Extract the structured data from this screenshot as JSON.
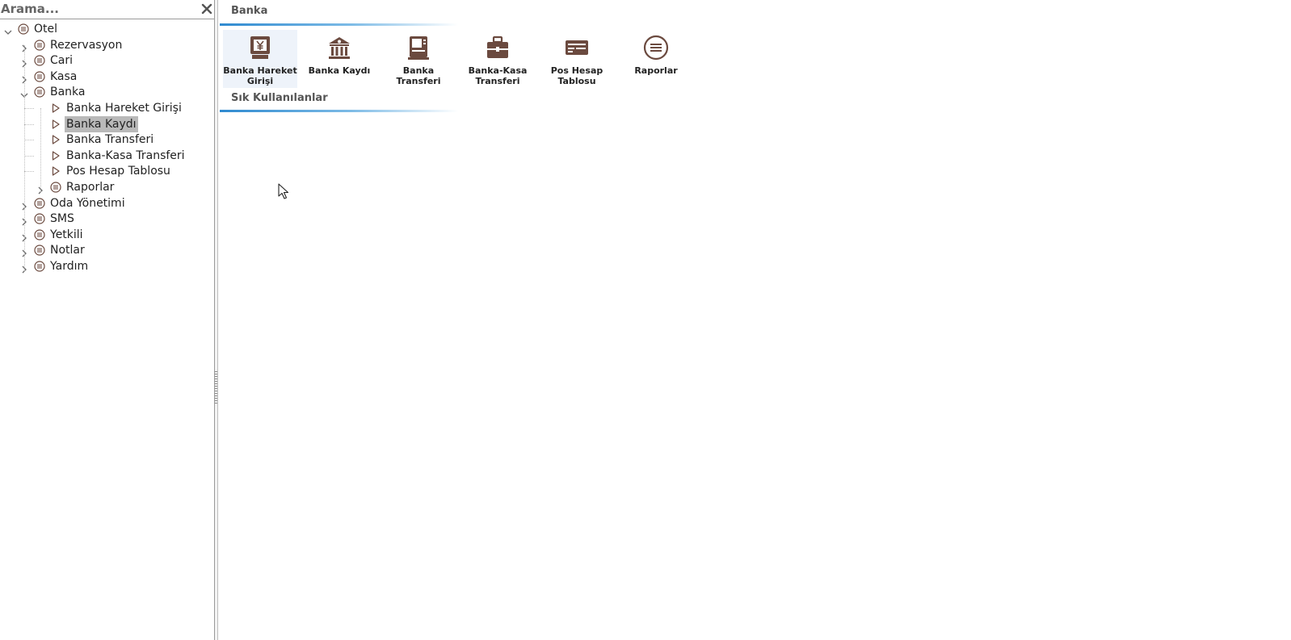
{
  "search": {
    "placeholder": "Arama..."
  },
  "tree": [
    {
      "label": "Otel",
      "level": 0,
      "expander": "expanded",
      "icon": "list-circle-icon"
    },
    {
      "label": "Rezervasyon",
      "level": 1,
      "expander": "collapsed",
      "icon": "list-circle-icon"
    },
    {
      "label": "Cari",
      "level": 1,
      "expander": "collapsed",
      "icon": "list-circle-icon"
    },
    {
      "label": "Kasa",
      "level": 1,
      "expander": "collapsed",
      "icon": "list-circle-icon"
    },
    {
      "label": "Banka",
      "level": 1,
      "expander": "expanded",
      "icon": "list-circle-icon"
    },
    {
      "label": "Banka Hareket Girişi",
      "level": 2,
      "expander": "none",
      "icon": "triangle-right-icon"
    },
    {
      "label": "Banka Kaydı",
      "level": 2,
      "expander": "none",
      "icon": "triangle-right-icon",
      "selected": true
    },
    {
      "label": "Banka Transferi",
      "level": 2,
      "expander": "none",
      "icon": "triangle-right-icon"
    },
    {
      "label": "Banka-Kasa Transferi",
      "level": 2,
      "expander": "none",
      "icon": "triangle-right-icon"
    },
    {
      "label": "Pos Hesap Tablosu",
      "level": 2,
      "expander": "none",
      "icon": "triangle-right-icon"
    },
    {
      "label": "Raporlar",
      "level": 2,
      "expander": "collapsed",
      "icon": "list-circle-icon"
    },
    {
      "label": "Oda Yönetimi",
      "level": 1,
      "expander": "collapsed",
      "icon": "list-circle-icon"
    },
    {
      "label": "SMS",
      "level": 1,
      "expander": "collapsed",
      "icon": "list-circle-icon"
    },
    {
      "label": "Yetkili",
      "level": 1,
      "expander": "collapsed",
      "icon": "list-circle-icon"
    },
    {
      "label": "Notlar",
      "level": 1,
      "expander": "collapsed",
      "icon": "list-circle-icon"
    },
    {
      "label": "Yardım",
      "level": 1,
      "expander": "collapsed",
      "icon": "list-circle-icon"
    }
  ],
  "main": {
    "group_title": "Banka",
    "tiles": [
      {
        "label": "Banka Hareket Girişi",
        "icon": "atm-yen-icon",
        "active": true
      },
      {
        "label": "Banka Kaydı",
        "icon": "bank-building-icon"
      },
      {
        "label": "Banka Transferi",
        "icon": "atm-machine-icon"
      },
      {
        "label": "Banka-Kasa Transferi",
        "icon": "cash-register-icon"
      },
      {
        "label": "Pos Hesap Tablosu",
        "icon": "pos-card-icon"
      },
      {
        "label": "Raporlar",
        "icon": "list-circle-icon"
      }
    ],
    "favorites_title": "Sık Kullanılanlar"
  },
  "colors": {
    "icon_brown": "#6b4a3f",
    "accent_blue": "#2f8ad0",
    "selection_gray": "#b9b9b9"
  }
}
